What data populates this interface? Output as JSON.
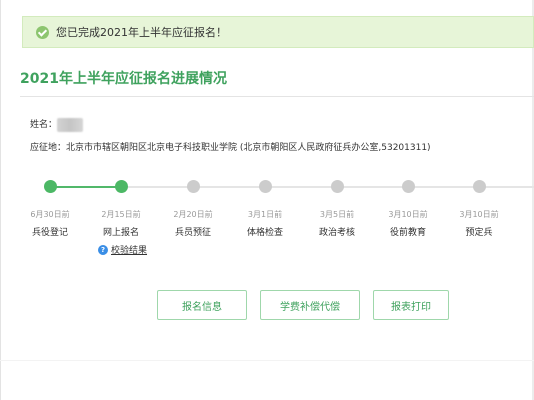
{
  "alert": {
    "message": "您已完成2021年上半年应征报名！"
  },
  "page_title": "2021年上半年应征报名进展情况",
  "info": {
    "name_label": "姓名：",
    "site_label": "应征地：",
    "site_value": "北京市市辖区朝阳区北京电子科技职业学院 (北京市朝阳区人民政府征兵办公室,53201311)"
  },
  "steps": [
    {
      "date": "6月30日前",
      "label": "兵役登记",
      "status": "done"
    },
    {
      "date": "2月15日前",
      "label": "网上报名",
      "status": "done"
    },
    {
      "date": "2月20日前",
      "label": "兵员预征",
      "status": "pending"
    },
    {
      "date": "3月1日前",
      "label": "体格检查",
      "status": "pending"
    },
    {
      "date": "3月5日前",
      "label": "政治考核",
      "status": "pending"
    },
    {
      "date": "3月10日前",
      "label": "役前教育",
      "status": "pending"
    },
    {
      "date": "3月10日前",
      "label": "预定兵",
      "status": "pending"
    }
  ],
  "check_result": {
    "icon": "question-icon",
    "label": "校验结果"
  },
  "buttons": {
    "info": "报名信息",
    "tuition": "学费补偿代偿",
    "print": "报表打印"
  },
  "colors": {
    "accent": "#3fa25e",
    "done": "#4cb865",
    "pending": "#cccccc",
    "alert_bg": "#e7f5d8"
  }
}
